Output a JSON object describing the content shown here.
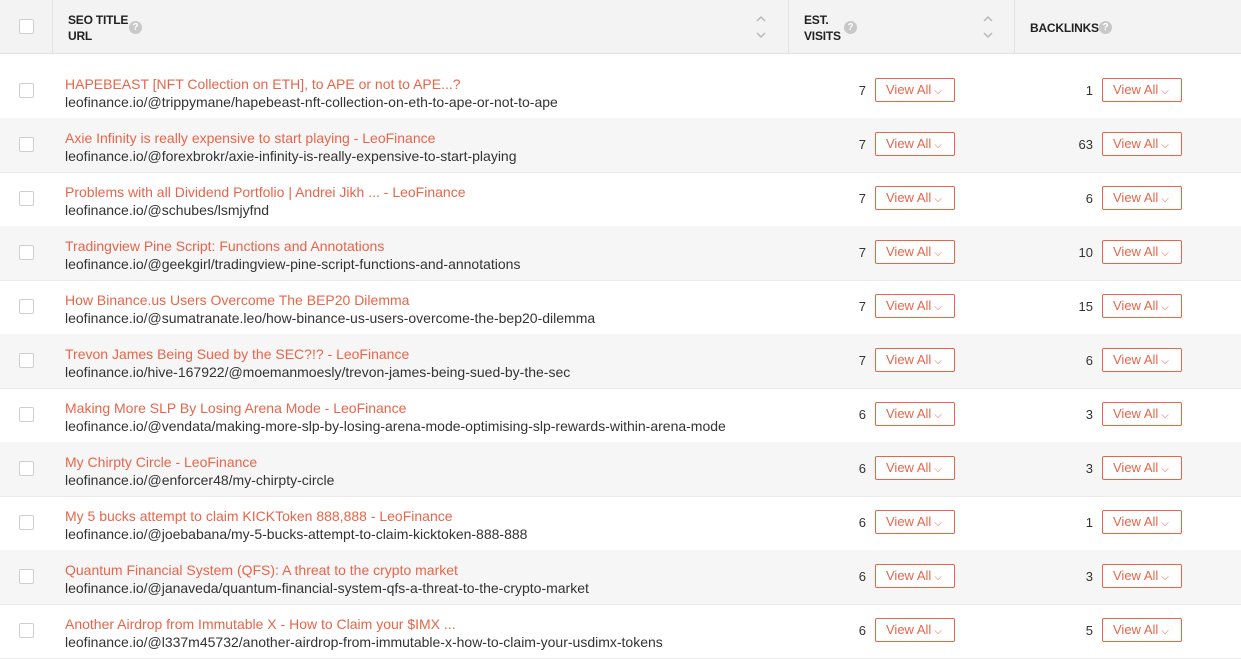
{
  "header": {
    "title_label": "SEO TITLE",
    "url_label": "URL",
    "visits_label_1": "EST.",
    "visits_label_2": "VISITS",
    "backlinks_label": "BACKLINKS",
    "help_glyph": "?"
  },
  "button_label": "View All",
  "chevron_glyph": "⌵",
  "colors": {
    "accent": "#e8654a",
    "header_bg": "#f3f3f3",
    "row_alt": "#f6f6f6"
  },
  "rows": [
    {
      "title": "HAPEBEAST [NFT Collection on ETH], to APE or not to APE...?",
      "url": "leofinance.io/@trippymane/hapebeast-nft-collection-on-eth-to-ape-or-not-to-ape",
      "visits": "7",
      "backlinks": "1"
    },
    {
      "title": "Axie Infinity is really expensive to start playing - LeoFinance",
      "url": "leofinance.io/@forexbrokr/axie-infinity-is-really-expensive-to-start-playing",
      "visits": "7",
      "backlinks": "63"
    },
    {
      "title": "Problems with all Dividend Portfolio | Andrei Jikh ... - LeoFinance",
      "url": "leofinance.io/@schubes/lsmjyfnd",
      "visits": "7",
      "backlinks": "6"
    },
    {
      "title": "Tradingview Pine Script: Functions and Annotations",
      "url": "leofinance.io/@geekgirl/tradingview-pine-script-functions-and-annotations",
      "visits": "7",
      "backlinks": "10"
    },
    {
      "title": "How Binance.us Users Overcome The BEP20 Dilemma",
      "url": "leofinance.io/@sumatranate.leo/how-binance-us-users-overcome-the-bep20-dilemma",
      "visits": "7",
      "backlinks": "15"
    },
    {
      "title": "Trevon James Being Sued by the SEC?!? - LeoFinance",
      "url": "leofinance.io/hive-167922/@moemanmoesly/trevon-james-being-sued-by-the-sec",
      "visits": "7",
      "backlinks": "6"
    },
    {
      "title": "Making More SLP By Losing Arena Mode - LeoFinance",
      "url": "leofinance.io/@vendata/making-more-slp-by-losing-arena-mode-optimising-slp-rewards-within-arena-mode",
      "visits": "6",
      "backlinks": "3"
    },
    {
      "title": "My Chirpty Circle - LeoFinance",
      "url": "leofinance.io/@enforcer48/my-chirpty-circle",
      "visits": "6",
      "backlinks": "3"
    },
    {
      "title": "My 5 bucks attempt to claim KICKToken 888,888 - LeoFinance",
      "url": "leofinance.io/@joebabana/my-5-bucks-attempt-to-claim-kicktoken-888-888",
      "visits": "6",
      "backlinks": "1"
    },
    {
      "title": "Quantum Financial System (QFS): A threat to the crypto market",
      "url": "leofinance.io/@janaveda/quantum-financial-system-qfs-a-threat-to-the-crypto-market",
      "visits": "6",
      "backlinks": "3"
    },
    {
      "title": "Another Airdrop from Immutable X - How to Claim your $IMX ...",
      "url": "leofinance.io/@l337m45732/another-airdrop-from-immutable-x-how-to-claim-your-usdimx-tokens",
      "visits": "6",
      "backlinks": "5"
    }
  ]
}
